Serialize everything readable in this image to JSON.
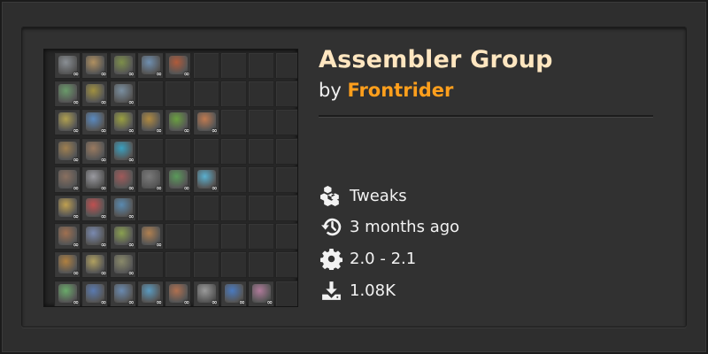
{
  "mod": {
    "title": "Assembler Group",
    "by_prefix": "by ",
    "author": "Frontrider"
  },
  "meta": {
    "category": "Tweaks",
    "updated": "3 months ago",
    "version": "2.0 - 2.1",
    "downloads": "1.08K"
  },
  "icons": {
    "category": "cubes-icon",
    "updated": "history-icon",
    "version": "gear-icon",
    "downloads": "download-icon"
  },
  "thumbnail": {
    "badge_text": "∞",
    "rows": [
      [
        "#8a8f94",
        "#b09060",
        "#7d8f4a",
        "#6f8fb0",
        "#b05a3a"
      ],
      [
        "#6a9a6a",
        "#a09040",
        "#7a8fa0"
      ],
      [
        "#b0a050",
        "#5a8ac0",
        "#9aa040",
        "#b08a40",
        "#6aa040",
        "#c07a50"
      ],
      [
        "#a08050",
        "#9a7a60",
        "#3aa0c0"
      ],
      [
        "#8a7060",
        "#9a9aa0",
        "#a05a5a",
        "#7a7a7a",
        "#5a9a5a",
        "#5ab0d0"
      ],
      [
        "#c0a050",
        "#c05050",
        "#5a8ab0"
      ],
      [
        "#a07050",
        "#7a8ab0",
        "#8aa050",
        "#b08050"
      ],
      [
        "#b08040",
        "#b0a060",
        "#8a8a6a"
      ],
      [
        "#6aaa6a",
        "#5a7ab0",
        "#6a8ab0",
        "#5a9ac0",
        "#b07050",
        "#9a9a9a",
        "#4a7ac0",
        "#b07a9a"
      ]
    ]
  }
}
